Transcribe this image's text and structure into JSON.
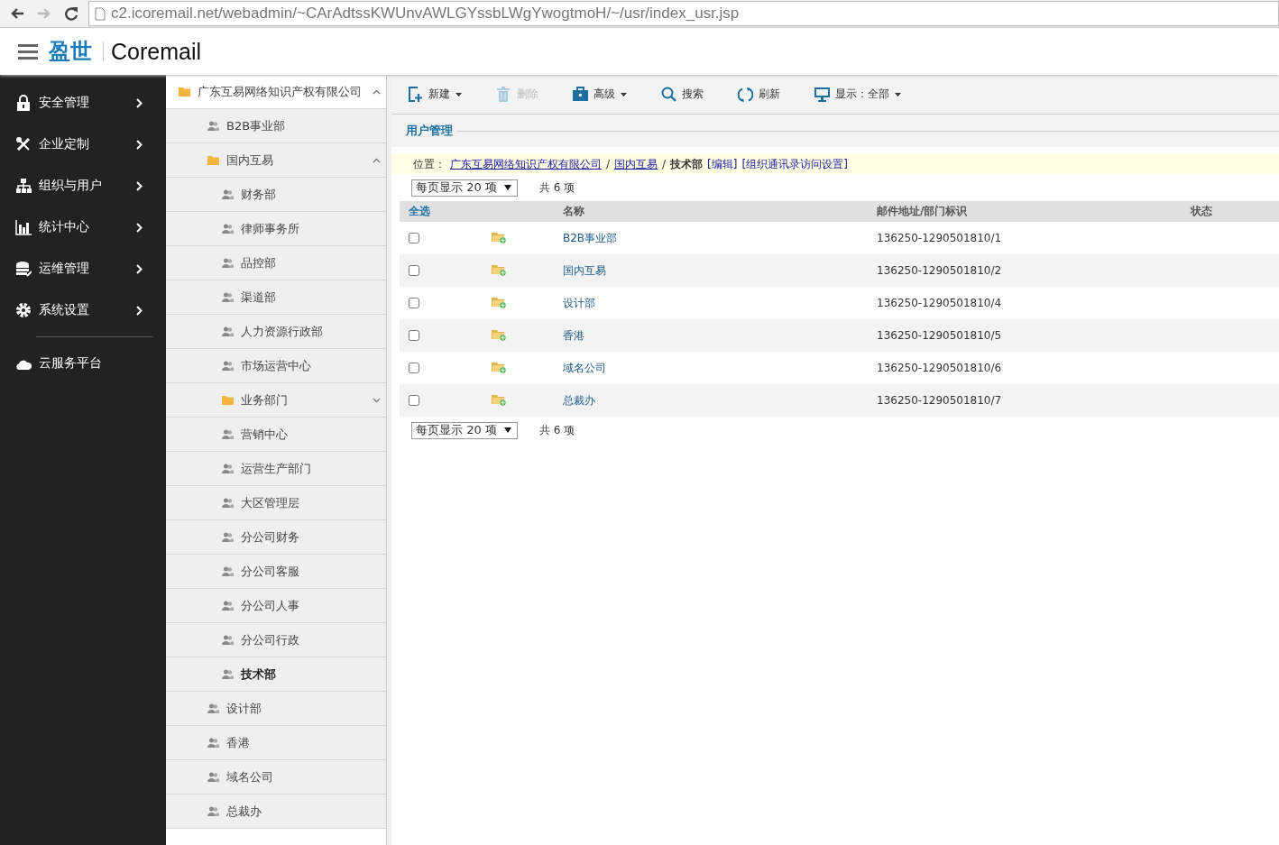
{
  "browser": {
    "buttons": [
      {
        "kind": "back",
        "disabled": false
      },
      {
        "kind": "forward",
        "disabled": true
      },
      {
        "kind": "reload",
        "disabled": false
      }
    ],
    "url": "c2.icoremail.net/webadmin/~CArAdtssKWUnvAWLGYssbLWgYwogtmoH/~/usr/index_usr.jsp"
  },
  "header": {
    "logo_cn": "盈世",
    "logo_en": "Coremail"
  },
  "nav": {
    "groups": [
      [
        {
          "label": "安全管理",
          "kind": "lock",
          "has_submenu": true
        },
        {
          "label": "企业定制",
          "kind": "tools",
          "has_submenu": true
        },
        {
          "label": "组织与用户",
          "kind": "org",
          "has_submenu": true
        },
        {
          "label": "统计中心",
          "kind": "chart",
          "has_submenu": true
        },
        {
          "label": "运维管理",
          "kind": "database",
          "has_submenu": true
        },
        {
          "label": "系统设置",
          "kind": "gear",
          "has_submenu": true
        }
      ],
      [
        {
          "label": "云服务平台",
          "kind": "cloud",
          "has_submenu": false
        }
      ]
    ]
  },
  "tree": {
    "items": [
      {
        "label": "广东互易网络知识产权有限公司",
        "kind": "folder",
        "expanded": true,
        "selected": false,
        "children": [
          {
            "label": "B2B事业部",
            "kind": "group",
            "selected": false
          },
          {
            "label": "国内互易",
            "kind": "folder",
            "expanded": true,
            "selected": false,
            "children": [
              {
                "label": "财务部",
                "kind": "group",
                "selected": false
              },
              {
                "label": "律师事务所",
                "kind": "group",
                "selected": false
              },
              {
                "label": "品控部",
                "kind": "group",
                "selected": false
              },
              {
                "label": "渠道部",
                "kind": "group",
                "selected": false
              },
              {
                "label": "人力资源行政部",
                "kind": "group",
                "selected": false
              },
              {
                "label": "市场运营中心",
                "kind": "group",
                "selected": false
              },
              {
                "label": "业务部门",
                "kind": "folder",
                "expanded": false,
                "selected": false
              },
              {
                "label": "营销中心",
                "kind": "group",
                "selected": false
              },
              {
                "label": "运营生产部门",
                "kind": "group",
                "selected": false
              },
              {
                "label": "大区管理层",
                "kind": "group",
                "selected": false
              },
              {
                "label": "分公司财务",
                "kind": "group",
                "selected": false
              },
              {
                "label": "分公司客服",
                "kind": "group",
                "selected": false
              },
              {
                "label": "分公司人事",
                "kind": "group",
                "selected": false
              },
              {
                "label": "分公司行政",
                "kind": "group",
                "selected": false
              },
              {
                "label": "技术部",
                "kind": "group",
                "selected": true
              }
            ]
          },
          {
            "label": "设计部",
            "kind": "group",
            "selected": false
          },
          {
            "label": "香港",
            "kind": "group",
            "selected": false
          },
          {
            "label": "域名公司",
            "kind": "group",
            "selected": false
          },
          {
            "label": "总裁办",
            "kind": "group",
            "selected": false
          }
        ]
      }
    ]
  },
  "toolbar": {
    "items": [
      {
        "label": "新建",
        "dropdown": true,
        "disabled": false
      },
      {
        "label": "删除",
        "dropdown": false,
        "disabled": true
      },
      {
        "label": "高级",
        "dropdown": true,
        "disabled": false
      },
      {
        "label": "搜索",
        "dropdown": false,
        "disabled": false
      },
      {
        "label": "刷新",
        "dropdown": false,
        "disabled": false
      },
      {
        "label": "显示：全部",
        "dropdown": true,
        "disabled": false
      }
    ]
  },
  "section_title": "用户管理",
  "location": {
    "parts": [
      {
        "kind": "label",
        "text": "位置："
      },
      {
        "kind": "link",
        "text": "广东互易网络知识产权有限公司"
      },
      {
        "kind": "separator",
        "text": "/"
      },
      {
        "kind": "link",
        "text": "国内互易"
      },
      {
        "kind": "separator",
        "text": "/"
      },
      {
        "kind": "current",
        "text": "技术部"
      },
      {
        "kind": "action",
        "text": "[编辑]"
      },
      {
        "kind": "action",
        "text": "[组织通讯录访问设置]"
      }
    ]
  },
  "pager_top": {
    "page_size": "每页显示 20 项",
    "total": "共 6 项"
  },
  "table": {
    "columns": [
      "全选",
      "名称",
      "邮件地址/部门标识",
      "状态"
    ],
    "rows": [
      {
        "checked": false,
        "name": "B2B事业部",
        "id": "136250-1290501810/1"
      },
      {
        "checked": false,
        "name": "国内互易",
        "id": "136250-1290501810/2"
      },
      {
        "checked": false,
        "name": "设计部",
        "id": "136250-1290501810/4"
      },
      {
        "checked": false,
        "name": "香港",
        "id": "136250-1290501810/5"
      },
      {
        "checked": false,
        "name": "域名公司",
        "id": "136250-1290501810/6"
      },
      {
        "checked": false,
        "name": "总裁办",
        "id": "136250-1290501810/7"
      }
    ]
  },
  "pager_bottom": {
    "page_size": "每页显示 20 项",
    "total": "共 6 项"
  }
}
